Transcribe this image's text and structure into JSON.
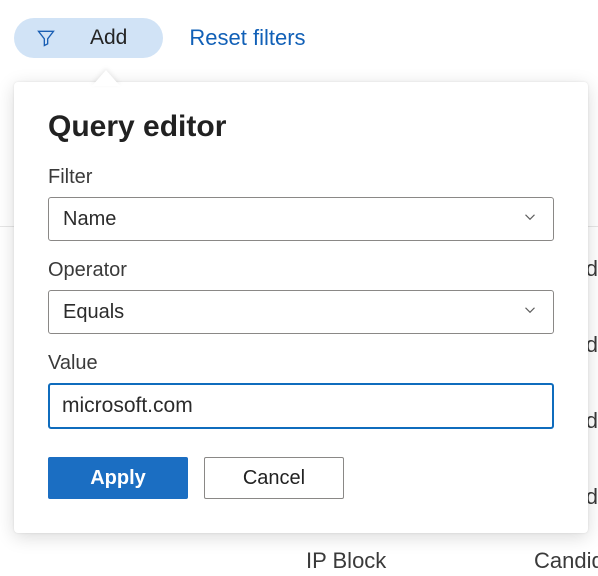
{
  "topbar": {
    "add_label": "Add",
    "reset_label": "Reset filters"
  },
  "panel": {
    "title": "Query editor",
    "filter_label": "Filter",
    "filter_value": "Name",
    "operator_label": "Operator",
    "operator_value": "Equals",
    "value_label": "Value",
    "value_input": "microsoft.com",
    "apply_label": "Apply",
    "cancel_label": "Cancel"
  },
  "background": {
    "ip_block": "IP Block",
    "candid": "Candid",
    "d1": "d",
    "d2": "d",
    "d3": "d",
    "d4": "d"
  }
}
